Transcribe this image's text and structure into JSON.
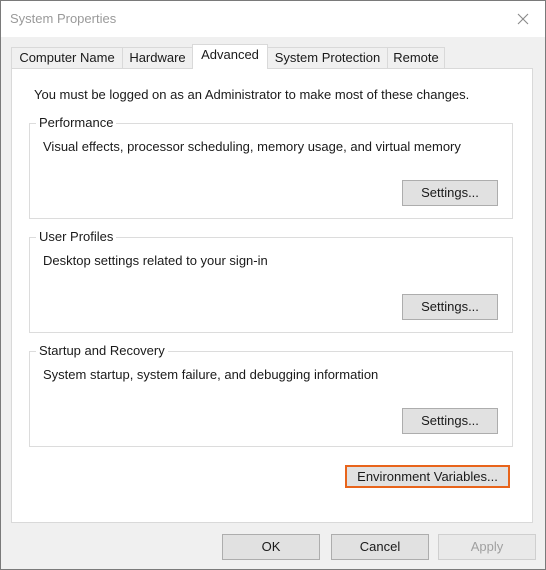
{
  "window": {
    "title": "System Properties"
  },
  "tabs": [
    {
      "label": "Computer Name"
    },
    {
      "label": "Hardware"
    },
    {
      "label": "Advanced",
      "active": true
    },
    {
      "label": "System Protection"
    },
    {
      "label": "Remote"
    }
  ],
  "advanced": {
    "admin_note": "You must be logged on as an Administrator to make most of these changes.",
    "performance": {
      "title": "Performance",
      "description": "Visual effects, processor scheduling, memory usage, and virtual memory",
      "button": "Settings..."
    },
    "user_profiles": {
      "title": "User Profiles",
      "description": "Desktop settings related to your sign-in",
      "button": "Settings..."
    },
    "startup_recovery": {
      "title": "Startup and Recovery",
      "description": "System startup, system failure, and debugging information",
      "button": "Settings..."
    },
    "env_button": "Environment Variables..."
  },
  "footer": {
    "ok": "OK",
    "cancel": "Cancel",
    "apply": "Apply"
  },
  "colors": {
    "highlight_border": "#e8641b",
    "window_bg": "#f0f0f0",
    "panel_bg": "#ffffff"
  },
  "icons": {
    "close": "close-icon"
  }
}
